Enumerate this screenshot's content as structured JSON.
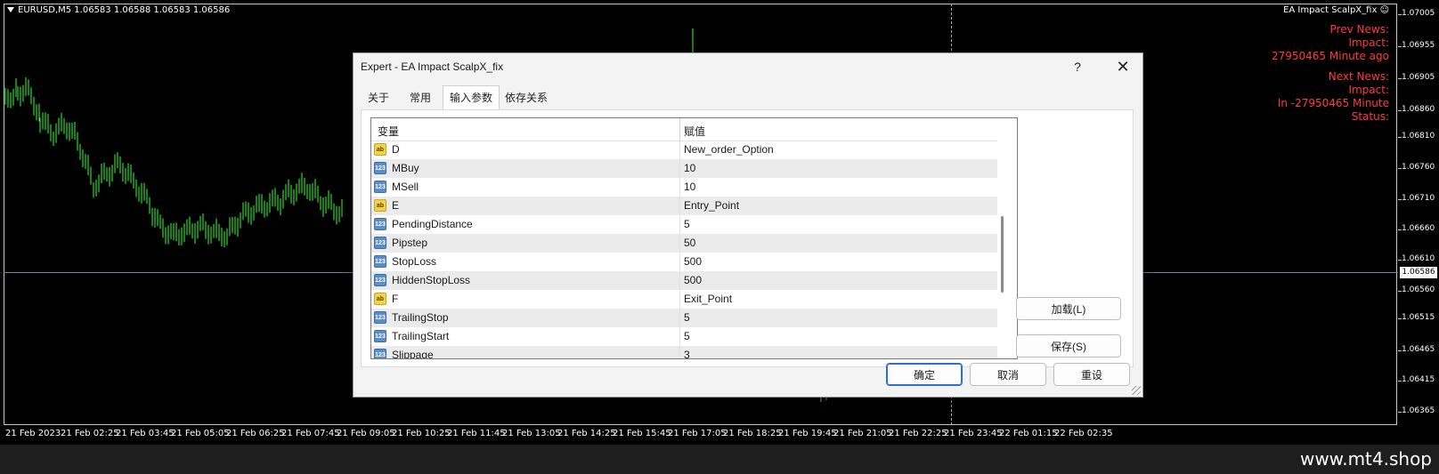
{
  "chart": {
    "symbol_info": "EURUSD,M5  1.06583 1.06588 1.06583 1.06586",
    "ea_name": "EA Impact ScalpX_fix",
    "prev_news": [
      "Prev News:",
      "Impact:",
      "27950465 Minute ago"
    ],
    "next_news": [
      "Next News:",
      "Impact:",
      "In -27950465 Minute",
      "Status:"
    ],
    "price_labels": [
      "1.07005",
      "1.06955",
      "1.06905",
      "1.06860",
      "1.06810",
      "1.06760",
      "1.06710",
      "1.06660",
      "1.06610",
      "1.06560",
      "1.06515",
      "1.06465",
      "1.06415",
      "1.06365"
    ],
    "current_price": "1.06586",
    "time_labels": [
      "21 Feb 2023",
      "21 Feb 02:25",
      "21 Feb 03:45",
      "21 Feb 05:05",
      "21 Feb 06:25",
      "21 Feb 07:45",
      "21 Feb 09:05",
      "21 Feb 10:25",
      "21 Feb 11:45",
      "21 Feb 13:05",
      "21 Feb 14:25",
      "21 Feb 15:45",
      "21 Feb 17:05",
      "21 Feb 18:25",
      "21 Feb 19:45",
      "21 Feb 21:05",
      "21 Feb 22:25",
      "21 Feb 23:45",
      "22 Feb 01:15",
      "22 Feb 02:35"
    ],
    "candle_color": "#33ff33",
    "news_color": "#ff3b3b"
  },
  "dialog": {
    "title": "Expert - EA Impact ScalpX_fix",
    "help": "?",
    "close": "✕",
    "tabs": [
      "关于",
      "常用",
      "输入参数",
      "依存关系"
    ],
    "active_tab": 2,
    "columns": [
      "变量",
      "赋值"
    ],
    "params": [
      {
        "type": "ab",
        "name": "D",
        "value": "New_order_Option"
      },
      {
        "type": "123",
        "name": "MBuy",
        "value": "10"
      },
      {
        "type": "123",
        "name": "MSell",
        "value": "10"
      },
      {
        "type": "ab",
        "name": "E",
        "value": "Entry_Point"
      },
      {
        "type": "123",
        "name": "PendingDistance",
        "value": "5"
      },
      {
        "type": "123",
        "name": "Pipstep",
        "value": "50"
      },
      {
        "type": "123",
        "name": "StopLoss",
        "value": "500"
      },
      {
        "type": "123",
        "name": "HiddenStopLoss",
        "value": "500"
      },
      {
        "type": "ab",
        "name": "F",
        "value": "Exit_Point"
      },
      {
        "type": "123",
        "name": "TrailingStop",
        "value": "5"
      },
      {
        "type": "123",
        "name": "TrailingStart",
        "value": "5"
      },
      {
        "type": "123",
        "name": "Slippage",
        "value": "3"
      }
    ],
    "load_button": "加载(L)",
    "save_button": "保存(S)",
    "ok_button": "确定",
    "cancel_button": "取消",
    "reset_button": "重设"
  },
  "footer": {
    "watermark": "www.mt4.shop"
  }
}
